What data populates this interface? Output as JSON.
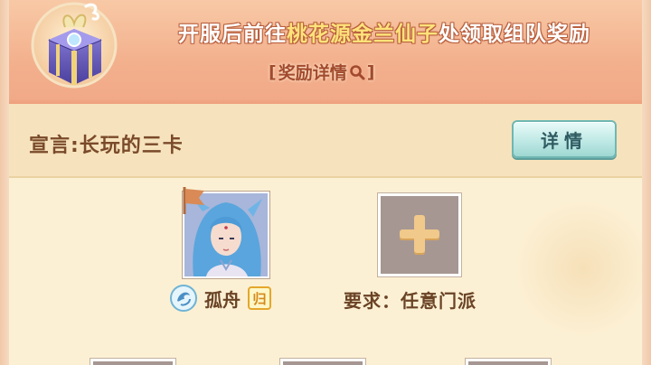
{
  "banner": {
    "headline_pre": "开服后前往",
    "headline_highlight": "桃花源金兰仙子",
    "headline_post": "处领取组队奖励",
    "reward_link_open": "[",
    "reward_link_label": "奖励详情",
    "reward_link_close": "]"
  },
  "declaration": {
    "label": "宣言:长玩的三卡",
    "detail_button": "详情"
  },
  "members": {
    "member1": {
      "name": "孤舟",
      "badge": "归"
    },
    "slot2": {
      "requirement": "要求：任意门派"
    }
  },
  "colors": {
    "banner": "#f3b08d",
    "highlight": "#ffe27a",
    "panel": "#fdf0d6",
    "button_teal": "#bfe9e5",
    "text_brown": "#6a4325"
  },
  "icons": [
    "gift-box-icon",
    "search-icon",
    "school-emblem-icon",
    "plus-icon",
    "flag-icon"
  ]
}
